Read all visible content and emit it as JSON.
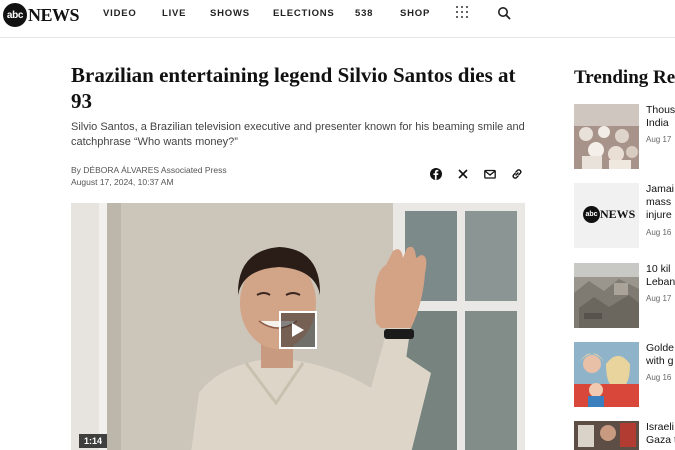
{
  "header": {
    "logo_mark": "abc",
    "logo_text": "NEWS",
    "nav": [
      "VIDEO",
      "LIVE",
      "SHOWS",
      "ELECTIONS",
      "538",
      "SHOP"
    ]
  },
  "article": {
    "headline": "Brazilian entertaining legend Silvio Santos dies at 93",
    "dek": "Silvio Santos, a Brazilian television executive and presenter known for his beaming smile and catchphrase “Who wants money?”",
    "byline_prefix": "By",
    "author": "DÉBORA ÁLVARES Associated Press",
    "timestamp": "August 17, 2024, 10:37 AM",
    "share_icons": [
      "facebook-icon",
      "x-icon",
      "email-icon",
      "link-icon"
    ],
    "video": {
      "duration": "1:14"
    }
  },
  "trending": {
    "title": "Trending Re",
    "items": [
      {
        "line1": "Thous",
        "line2": "India",
        "date": "Aug 17"
      },
      {
        "line1": "Jamai",
        "line2": "mass",
        "line3": "injure",
        "date": "Aug 16",
        "thumb_logo_mark": "abc",
        "thumb_logo_text": "NEWS"
      },
      {
        "line1": "10 kil",
        "line2": "Leban",
        "date": "Aug 17"
      },
      {
        "line1": "Golde",
        "line2": "with g",
        "date": "Aug 16"
      },
      {
        "line1": "Israeli",
        "line2": "Gaza t"
      }
    ]
  },
  "colors": {
    "brand": "#111111",
    "accent_text": "#444444"
  }
}
